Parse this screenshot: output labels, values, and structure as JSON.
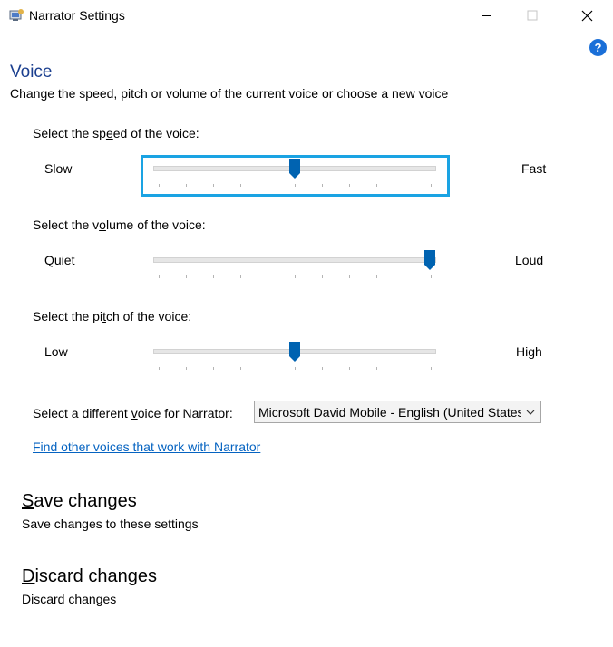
{
  "window": {
    "title": "Narrator Settings",
    "icons": [
      "app-icon",
      "minimize-icon",
      "maximize-icon",
      "close-icon",
      "help-icon"
    ]
  },
  "header": {
    "title": "Voice",
    "subtitle": "Change the speed, pitch or volume of the current voice or choose a new voice"
  },
  "sliders": {
    "speed": {
      "label_before": "Select the sp",
      "label_access": "e",
      "label_after": "ed of the voice:",
      "min_label": "Slow",
      "max_label": "Fast",
      "value_fraction": 0.5,
      "focused": true
    },
    "volume": {
      "label_before": "Select the v",
      "label_access": "o",
      "label_after": "lume of the voice:",
      "min_label": "Quiet",
      "max_label": "Loud",
      "value_fraction": 1.0,
      "focused": false
    },
    "pitch": {
      "label_before": "Select the pi",
      "label_access": "t",
      "label_after": "ch of the voice:",
      "min_label": "Low",
      "max_label": "High",
      "value_fraction": 0.5,
      "focused": false
    }
  },
  "voice": {
    "label_before": "Select a different ",
    "label_access": "v",
    "label_after": "oice for Narrator:",
    "selected": "Microsoft David Mobile - English (United States)"
  },
  "find_voices_link": "Find other voices that work with Narrator",
  "save": {
    "title_access": "S",
    "title_rest": "ave changes",
    "subtitle": "Save changes to these settings"
  },
  "discard": {
    "title_access": "D",
    "title_rest": "iscard changes",
    "subtitle": "Discard changes"
  },
  "colors": {
    "accent": "#0063b1",
    "focus": "#1aa3e3",
    "title_blue": "#1b3f8f",
    "link": "#0563c1",
    "help": "#1a6fd8"
  }
}
